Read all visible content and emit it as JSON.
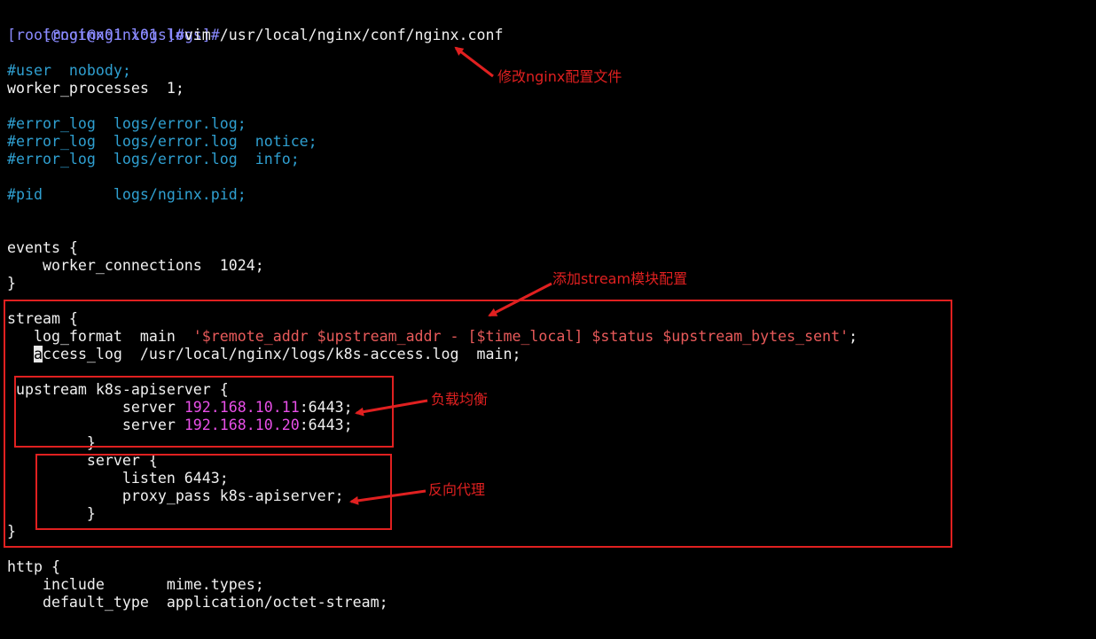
{
  "terminal": {
    "prompt1": "[root@nginx01 logs]#",
    "prompt2": "[root@nginx01 logs]#",
    "command": "vim /usr/local/nginx/conf/nginx.conf",
    "config": {
      "user_comment": "#user  nobody;",
      "worker_processes": "worker_processes  1;",
      "error_log_1": "#error_log  logs/error.log;",
      "error_log_2": "#error_log  logs/error.log  notice;",
      "error_log_3": "#error_log  logs/error.log  info;",
      "pid_comment": "#pid        logs/nginx.pid;",
      "events_open": "events {",
      "worker_connections": "    worker_connections  1024;",
      "events_close": "}",
      "stream_open": "stream {",
      "log_format_key": "   log_format  main  ",
      "log_format_value": "'$remote_addr $upstream_addr - [$time_local] $status $upstream_bytes_sent'",
      "log_format_end": ";",
      "access_log_cursor_char": "a",
      "access_log_rest": "ccess_log  /usr/local/nginx/logs/k8s-access.log  main;",
      "upstream_open": "upstream k8s-apiserver {",
      "server1_prefix": "             server ",
      "server1_ip": "192.168.10.11",
      "server1_suffix": ":6443;",
      "server2_prefix": "             server ",
      "server2_ip": "192.168.10.20",
      "server2_suffix": ":6443;",
      "upstream_close": "         }",
      "server_open": "         server {",
      "listen": "             listen 6443;",
      "proxy_pass": "             proxy_pass k8s-apiserver;",
      "server_close": "         }",
      "stream_close": "}",
      "http_open": "http {",
      "include": "    include       mime.types;",
      "default_type": "    default_type  application/octet-stream;"
    }
  },
  "annotations": {
    "edit_config": "修改nginx配置文件",
    "add_stream": "添加stream模块配置",
    "load_balance": "负载均衡",
    "reverse_proxy": "反向代理"
  },
  "colors": {
    "background": "#000000",
    "text": "#f0f0f0",
    "prompt": "#8a8aff",
    "comment": "#2f9fd0",
    "string": "#e85a5a",
    "ip": "#e84fe8",
    "annotation": "#e02020"
  }
}
